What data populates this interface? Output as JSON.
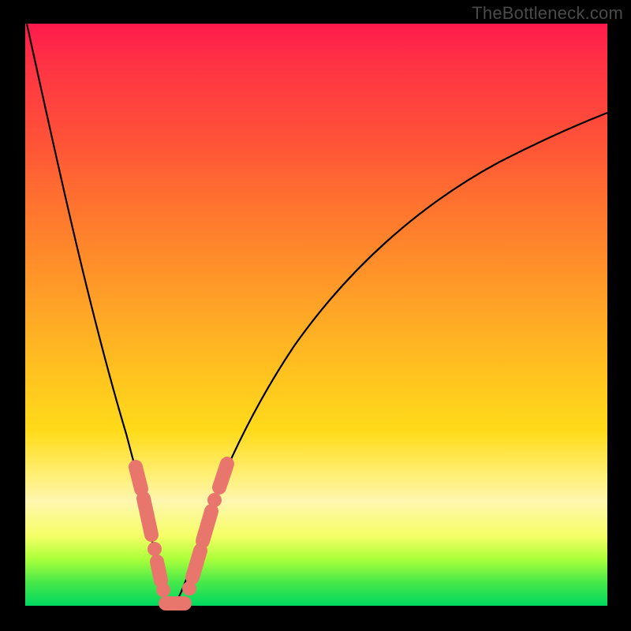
{
  "watermark": "TheBottleneck.com",
  "chart_data": {
    "type": "line",
    "title": "",
    "xlabel": "",
    "ylabel": "",
    "xlim": [
      0,
      100
    ],
    "ylim": [
      0,
      100
    ],
    "grid": false,
    "legend": false,
    "series": [
      {
        "name": "curve",
        "x": [
          0,
          4,
          8,
          12,
          16,
          18,
          20,
          21,
          22,
          23,
          24,
          26,
          28,
          30,
          34,
          40,
          48,
          58,
          70,
          84,
          100
        ],
        "y": [
          100,
          80,
          62,
          46,
          30,
          22,
          13,
          8,
          4,
          1,
          0,
          2,
          8,
          15,
          27,
          42,
          55,
          67,
          76,
          83,
          88
        ]
      }
    ],
    "annotations": {
      "highlighted_points_salmon": {
        "description": "Salmon-colored thick segments and beads clustered near the minimum of the V-shaped curve",
        "approx_x_range": [
          18,
          31
        ],
        "approx_y_range": [
          0,
          25
        ]
      }
    }
  }
}
